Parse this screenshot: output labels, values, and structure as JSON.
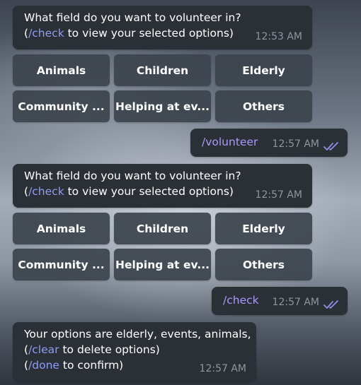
{
  "messages": [
    {
      "line1": "What field do you want to volunteer in?",
      "line2_cmd": "/check",
      "line2_text": " to view your selected options)",
      "line2_prefix": "(",
      "time": "12:53 AM",
      "buttons": [
        "Animals",
        "Children",
        "Elderly",
        "Community ...",
        "Helping at ev...",
        "Others"
      ]
    },
    {
      "command": "/volunteer",
      "time": "12:57 AM",
      "read_icon": "double-check-icon"
    },
    {
      "line1": "What field do you want to volunteer in?",
      "line2_cmd": "/check",
      "line2_text": " to view your selected options)",
      "line2_prefix": "(",
      "time": "12:57 AM",
      "buttons": [
        "Animals",
        "Children",
        "Elderly",
        "Community ...",
        "Helping at ev...",
        "Others"
      ]
    },
    {
      "command": "/check",
      "time": "12:57 AM",
      "read_icon": "double-check-icon"
    },
    {
      "line1": "Your options are elderly, events, animals,",
      "line2_prefix": "(",
      "line2_cmd": "/clear",
      "line2_text": " to delete options)",
      "line3_prefix": "(",
      "line3_cmd": "/done",
      "line3_text": " to confirm)",
      "time": "12:57 AM"
    }
  ],
  "colors": {
    "bubble_bg": "#2b3036",
    "button_bg": "#3c434c",
    "command_link": "#8e9cf6",
    "outgoing_command": "#a89af8",
    "timestamp": "#8f96a0",
    "read_check": "#8f8fe8"
  }
}
